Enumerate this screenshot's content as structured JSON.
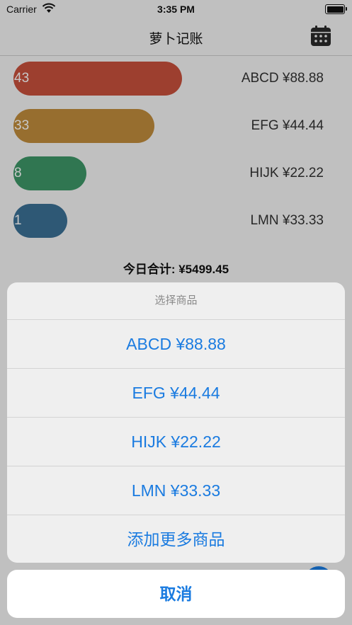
{
  "status": {
    "carrier": "Carrier",
    "time": "3:35 PM"
  },
  "nav": {
    "title": "萝卜记账",
    "right_icon": "calendar-icon"
  },
  "items": [
    {
      "count": "43",
      "name_price": "ABCD ¥88.88",
      "color": "#c9513d"
    },
    {
      "count": "33",
      "name_price": "EFG ¥44.44",
      "color": "#c28e3d"
    },
    {
      "count": "8",
      "name_price": "HIJK ¥22.22",
      "color": "#3e9868"
    },
    {
      "count": "1",
      "name_price": "LMN ¥33.33",
      "color": "#3c7196"
    }
  ],
  "total": "今日合计: ¥5499.45",
  "sheet": {
    "title": "选择商品",
    "options": [
      "ABCD ¥88.88",
      "EFG ¥44.44",
      "HIJK ¥22.22",
      "LMN ¥33.33",
      "添加更多商品"
    ],
    "cancel": "取消",
    "accent_color": "#1a7be0"
  }
}
